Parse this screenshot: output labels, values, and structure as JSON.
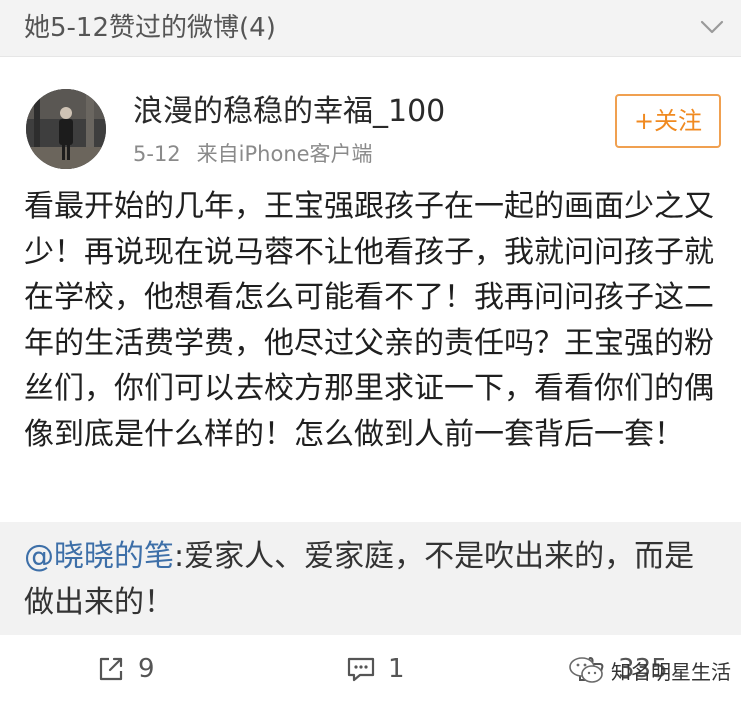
{
  "header": {
    "title": "她5-12赞过的微博(4)",
    "toggle_icon": "chevron-down-icon"
  },
  "post": {
    "author": {
      "name": "浪漫的稳稳的幸福_100",
      "avatar_icon": "avatar-photo"
    },
    "date": "5-12",
    "source": "来自iPhone客户端",
    "follow_label": "+关注",
    "text": "看最开始的几年，王宝强跟孩子在一起的画面少之又少！再说现在说马蓉不让他看孩子，我就问问孩子就在学校，他想看怎么可能看不了！我再问问孩子这二年的生活费学费，他尽过父亲的责任吗？王宝强的粉丝们，你们可以去校方那里求证一下，看看你们的偶像到底是什么样的！怎么做到人前一套背后一套！"
  },
  "quote": {
    "mention": "@晓晓的笔",
    "text": ":爱家人、爱家庭，不是吹出来的，而是做出来的！"
  },
  "actions": {
    "repost": {
      "icon": "share-icon",
      "count": "9"
    },
    "comment": {
      "icon": "comment-icon",
      "count": "1"
    },
    "like": {
      "icon": "like-icon",
      "count": "335"
    }
  },
  "watermark": {
    "text": "知名明星生活",
    "icon": "wechat-logo"
  },
  "colors": {
    "header_bg": "#f3f3f3",
    "follow_accent": "#f08a20",
    "mention": "#3d6fa8",
    "quote_bg": "#f2f2f2"
  }
}
